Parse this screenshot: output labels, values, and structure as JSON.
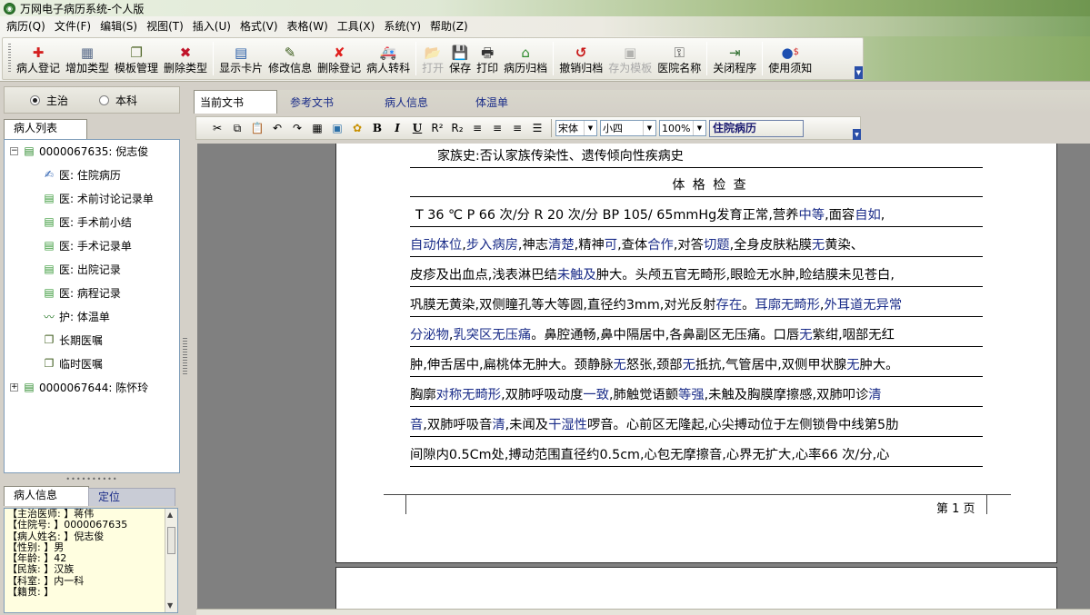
{
  "window": {
    "title": "万网电子病历系统-个人版",
    "app_icon": "app-logo-icon"
  },
  "menubar": [
    "病历(Q)",
    "文件(F)",
    "编辑(S)",
    "视图(T)",
    "插入(U)",
    "格式(V)",
    "表格(W)",
    "工具(X)",
    "系统(Y)",
    "帮助(Z)"
  ],
  "toolbar": {
    "buttons": [
      {
        "label": "病人登记",
        "icon": "red-cross-icon",
        "enabled": true
      },
      {
        "label": "增加类型",
        "icon": "table-add-icon",
        "enabled": true
      },
      {
        "label": "模板管理",
        "icon": "stack-icon",
        "enabled": true
      },
      {
        "label": "删除类型",
        "icon": "delete-type-icon",
        "enabled": true
      },
      {
        "label": "显示卡片",
        "icon": "card-grid-icon",
        "enabled": true
      },
      {
        "label": "修改信息",
        "icon": "edit-doc-icon",
        "enabled": true
      },
      {
        "label": "删除登记",
        "icon": "red-x-icon",
        "enabled": true
      },
      {
        "label": "病人转科",
        "icon": "ambulance-icon",
        "enabled": true
      },
      {
        "label": "打开",
        "icon": "folder-open-icon",
        "enabled": false
      },
      {
        "label": "保存",
        "icon": "save-icon",
        "enabled": true
      },
      {
        "label": "打印",
        "icon": "printer-icon",
        "enabled": true
      },
      {
        "label": "病历归档",
        "icon": "house-icon",
        "enabled": true
      },
      {
        "label": "撤销归档",
        "icon": "undo-archive-icon",
        "enabled": true
      },
      {
        "label": "存为模板",
        "icon": "save-template-icon",
        "enabled": false
      },
      {
        "label": "医院名称",
        "icon": "key-icon",
        "enabled": true
      },
      {
        "label": "关闭程序",
        "icon": "exit-door-icon",
        "enabled": true
      },
      {
        "label": "使用须知",
        "icon": "help-money-icon",
        "enabled": true
      }
    ]
  },
  "left": {
    "radio_main": "主治",
    "radio_dept": "本科",
    "tree_tab": "病人列表",
    "tree": [
      {
        "text": "0000067635: 倪志俊",
        "level": 0,
        "expanded": true,
        "icon": "patient-doc-icon"
      },
      {
        "text": "医: 住院病历",
        "level": 1,
        "icon": "doctor-edit-icon"
      },
      {
        "text": "医: 术前讨论记录单",
        "level": 1,
        "icon": "doc-green-icon"
      },
      {
        "text": "医: 手术前小结",
        "level": 1,
        "icon": "doc-green-icon"
      },
      {
        "text": "医: 手术记录单",
        "level": 1,
        "icon": "doc-green-icon"
      },
      {
        "text": "医: 出院记录",
        "level": 1,
        "icon": "doc-green-icon"
      },
      {
        "text": "医: 病程记录",
        "level": 1,
        "icon": "doc-green-icon"
      },
      {
        "text": "护: 体温单",
        "level": 1,
        "icon": "chart-icon"
      },
      {
        "text": "长期医嘱",
        "level": 1,
        "icon": "order-stack-icon"
      },
      {
        "text": "临时医嘱",
        "level": 1,
        "icon": "order-stack-icon"
      },
      {
        "text": "0000067644: 陈怀玲",
        "level": 0,
        "expanded": false,
        "icon": "patient-doc-icon"
      }
    ],
    "info_tabs": [
      "病人信息",
      "定位"
    ],
    "info": [
      "【主治医师: 】蒋伟",
      "【住院号: 】0000067635",
      "【病人姓名: 】倪志俊",
      "【性别: 】男",
      "【年龄: 】42",
      "【民族: 】汉族",
      "【科室: 】内一科",
      "【籍贯: 】"
    ]
  },
  "right": {
    "tabs": [
      "当前文书",
      "参考文书",
      "病人信息",
      "体温单"
    ],
    "format": {
      "font": "宋体",
      "size": "小四",
      "zoom": "100%",
      "style": "住院病历"
    },
    "document": {
      "lines": [
        [
          {
            "t": "家族史:否认家族传染性、遗传倾向性疾病史",
            "b": false
          }
        ],
        [
          {
            "t": "体 格 检 查",
            "b": false
          }
        ],
        [
          {
            "t": "T 36 ℃  P 66 次/分  R 20 次/分  BP 105/ 65mmHg发育正常,营养",
            "b": false
          },
          {
            "t": "中等",
            "b": true
          },
          {
            "t": ",面容",
            "b": false
          },
          {
            "t": "自如",
            "b": true
          },
          {
            "t": ",",
            "b": false
          }
        ],
        [
          {
            "t": "自动体位",
            "b": true
          },
          {
            "t": ",",
            "b": false
          },
          {
            "t": "步入病房",
            "b": true
          },
          {
            "t": ",神志",
            "b": false
          },
          {
            "t": "清楚",
            "b": true
          },
          {
            "t": ",精神",
            "b": false
          },
          {
            "t": "可",
            "b": true
          },
          {
            "t": ",查体",
            "b": false
          },
          {
            "t": "合作",
            "b": true
          },
          {
            "t": ",对答",
            "b": false
          },
          {
            "t": "切题",
            "b": true
          },
          {
            "t": ",全身皮肤粘膜",
            "b": false
          },
          {
            "t": "无",
            "b": true
          },
          {
            "t": "黄染、",
            "b": false
          }
        ],
        [
          {
            "t": "皮疹及出血点,浅表淋巴结",
            "b": false
          },
          {
            "t": "未触及",
            "b": true
          },
          {
            "t": "肿大。头颅五官无畸形,眼睑无水肿,睑结膜未见苍白,",
            "b": false
          }
        ],
        [
          {
            "t": "巩膜无黄染,双侧瞳孔等大等圆,直径约3mm,对光反射",
            "b": false
          },
          {
            "t": "存在",
            "b": true
          },
          {
            "t": "。",
            "b": false
          },
          {
            "t": "耳廓无畸形",
            "b": true
          },
          {
            "t": ",",
            "b": false
          },
          {
            "t": "外耳道无异常",
            "b": true
          }
        ],
        [
          {
            "t": "分泌物",
            "b": true
          },
          {
            "t": ",",
            "b": false
          },
          {
            "t": "乳突区无压痛",
            "b": true
          },
          {
            "t": "。鼻腔通畅,鼻中隔居中,各鼻副区无压痛。口唇",
            "b": false
          },
          {
            "t": "无",
            "b": true
          },
          {
            "t": "紫绀,咽部无红",
            "b": false
          }
        ],
        [
          {
            "t": "肿,伸舌居中,扁桃体无肿大。颈静脉",
            "b": false
          },
          {
            "t": "无",
            "b": true
          },
          {
            "t": "怒张,颈部",
            "b": false
          },
          {
            "t": "无",
            "b": true
          },
          {
            "t": "抵抗,气管居中,双侧甲状腺",
            "b": false
          },
          {
            "t": "无",
            "b": true
          },
          {
            "t": "肿大。",
            "b": false
          }
        ],
        [
          {
            "t": "胸廓",
            "b": false
          },
          {
            "t": "对称无畸形",
            "b": true
          },
          {
            "t": ",双肺呼吸动度",
            "b": false
          },
          {
            "t": "一致",
            "b": true
          },
          {
            "t": ",肺触觉语颤",
            "b": false
          },
          {
            "t": "等强",
            "b": true
          },
          {
            "t": ",未触及胸膜摩擦感,双肺叩诊",
            "b": false
          },
          {
            "t": "清",
            "b": true
          }
        ],
        [
          {
            "t": "音",
            "b": true
          },
          {
            "t": ",双肺呼吸音",
            "b": false
          },
          {
            "t": "清",
            "b": true
          },
          {
            "t": ",未闻及",
            "b": false
          },
          {
            "t": "干湿性",
            "b": true
          },
          {
            "t": "啰音。心前区无隆起,心尖搏动位于左侧锁骨中线第5肋",
            "b": false
          }
        ],
        [
          {
            "t": "间隙内0.5Cm处,搏动范围直径约0.5cm,心包无摩擦音,心界无扩大,心率66 次/分,心",
            "b": false
          }
        ]
      ],
      "page_number": "第 1 页"
    }
  }
}
